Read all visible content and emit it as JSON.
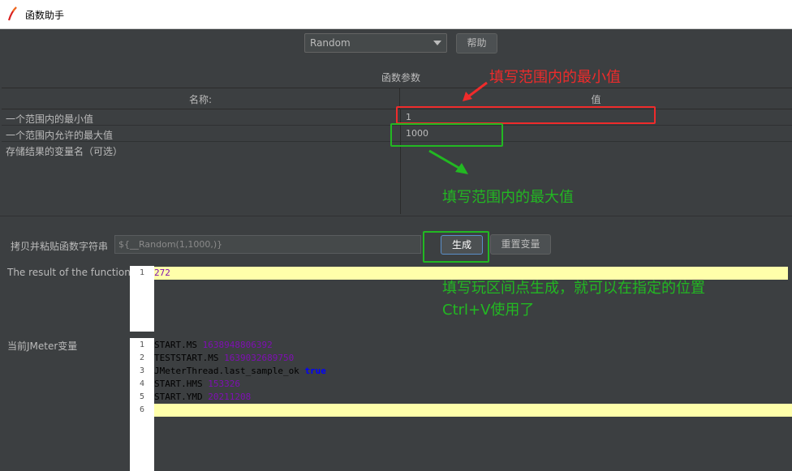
{
  "window": {
    "title": "函数助手"
  },
  "toolbar": {
    "function_selected": "Random",
    "help_label": "帮助"
  },
  "params": {
    "section_title": "函数参数",
    "col_name": "名称:",
    "col_value": "值",
    "rows": [
      {
        "name": "一个范围内的最小值",
        "value": "1"
      },
      {
        "name": "一个范围内允许的最大值",
        "value": "1000"
      },
      {
        "name": "存储结果的变量名（可选）",
        "value": ""
      }
    ]
  },
  "copy": {
    "label": "拷贝并粘贴函数字符串",
    "value": "${__Random(1,1000,)}",
    "generate_label": "生成",
    "reset_label": "重置变量"
  },
  "result": {
    "label": "The result of the function is",
    "lines": [
      {
        "n": "1",
        "text": "272"
      }
    ]
  },
  "vars": {
    "label": "当前JMeter变量",
    "lines": [
      {
        "n": "1",
        "key": "START.MS",
        "val": "1638948806392"
      },
      {
        "n": "2",
        "key": "TESTSTART.MS",
        "val": "1639032689750"
      },
      {
        "n": "3",
        "key": "JMeterThread.last_sample_ok",
        "val": "true"
      },
      {
        "n": "4",
        "key": "START.HMS",
        "val": "153326"
      },
      {
        "n": "5",
        "key": "START.YMD",
        "val": "20211208"
      },
      {
        "n": "6",
        "key": "",
        "val": ""
      }
    ]
  },
  "annotations": {
    "min_note": "填写范围内的最小值",
    "max_note": "填写范围内的最大值",
    "gen_note_line1": "填写玩区间点生成，就可以在指定的位置",
    "gen_note_line2": "Ctrl+V使用了",
    "red": "#ef2b2b",
    "green": "#22b822"
  }
}
